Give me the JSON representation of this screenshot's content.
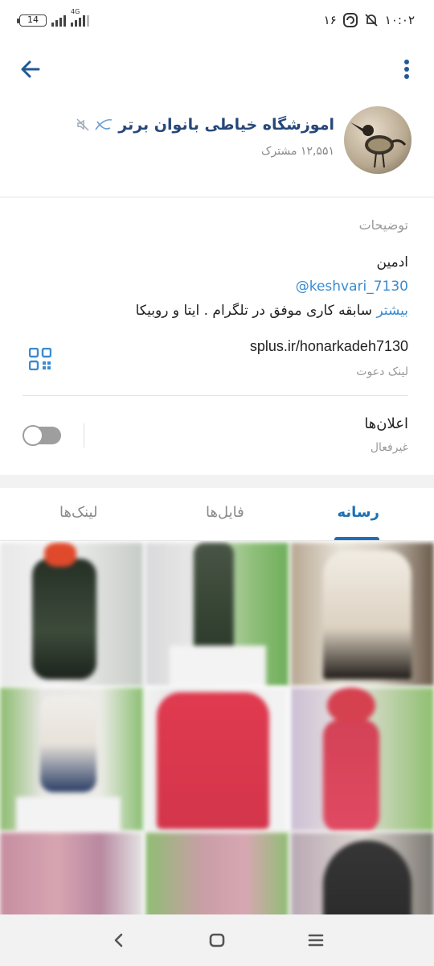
{
  "status_bar": {
    "time": "۱۰:۰۲",
    "notification_count": "۱۶",
    "battery_level": "14",
    "network_label": "4G"
  },
  "header": {
    "channel_title": "اموزشگاه خیاطی بانوان برتر",
    "subscribers": "۱۲,۵۵۱ مشترک"
  },
  "info": {
    "section_title": "توضیحات",
    "description_line1": "ادمین",
    "description_line2": "@keshvari_7130",
    "description_line3": "سابقه کاری موفق در تلگرام . ایتا و روبیکا",
    "more_label": "بیشتر",
    "invite_link": "splus.ir/honarkadeh7130",
    "invite_link_label": "لینک دعوت",
    "notifications_title": "اعلان‌ها",
    "notifications_status": "غیرفعال",
    "notifications_enabled": false
  },
  "tabs": {
    "media": "رسانه",
    "files": "فایل‌ها",
    "links": "لینک‌ها",
    "active": "media"
  },
  "colors": {
    "accent": "#1f6fb5",
    "title": "#27477a",
    "link": "#3a8bd0"
  },
  "icons": [
    "back-arrow-icon",
    "more-vert-icon",
    "muted-icon",
    "qr-code-icon",
    "nav-back-icon",
    "nav-home-icon",
    "nav-recents-icon"
  ]
}
